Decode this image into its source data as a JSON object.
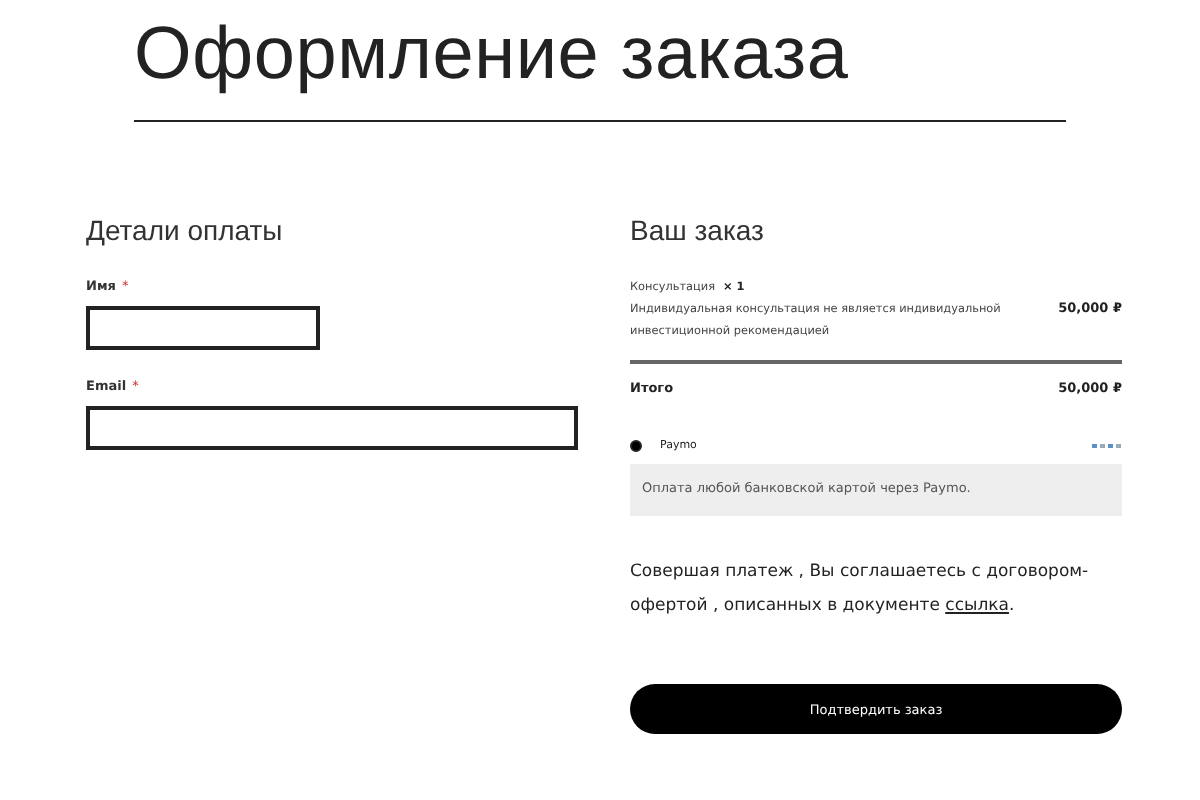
{
  "title": "Оформление заказа",
  "billing": {
    "heading": "Детали оплаты",
    "fields": [
      {
        "label": "Имя",
        "required_mark": "*",
        "kind": "short"
      },
      {
        "label": "Email",
        "required_mark": "*",
        "kind": "long"
      }
    ]
  },
  "order": {
    "heading": "Ваш заказ",
    "items": [
      {
        "name": "Консультация",
        "quantity": "× 1",
        "description": "Индивидуальная консультация не является индивидуальной инвестиционной рекомендацией",
        "price": "50,000 ₽"
      }
    ],
    "total": {
      "label": "Итого",
      "value": "50,000 ₽"
    },
    "payment_methods": [
      {
        "name": "Paymo",
        "selected": true,
        "description": "Оплата любой банковской картой через Paymo."
      }
    ],
    "agreement": {
      "text": "Совершая платеж , Вы соглашаетесь с договором-офертой , описанных в документе ",
      "link": "ссылка",
      "after": "."
    },
    "submit": "Подтвердить заказ"
  }
}
